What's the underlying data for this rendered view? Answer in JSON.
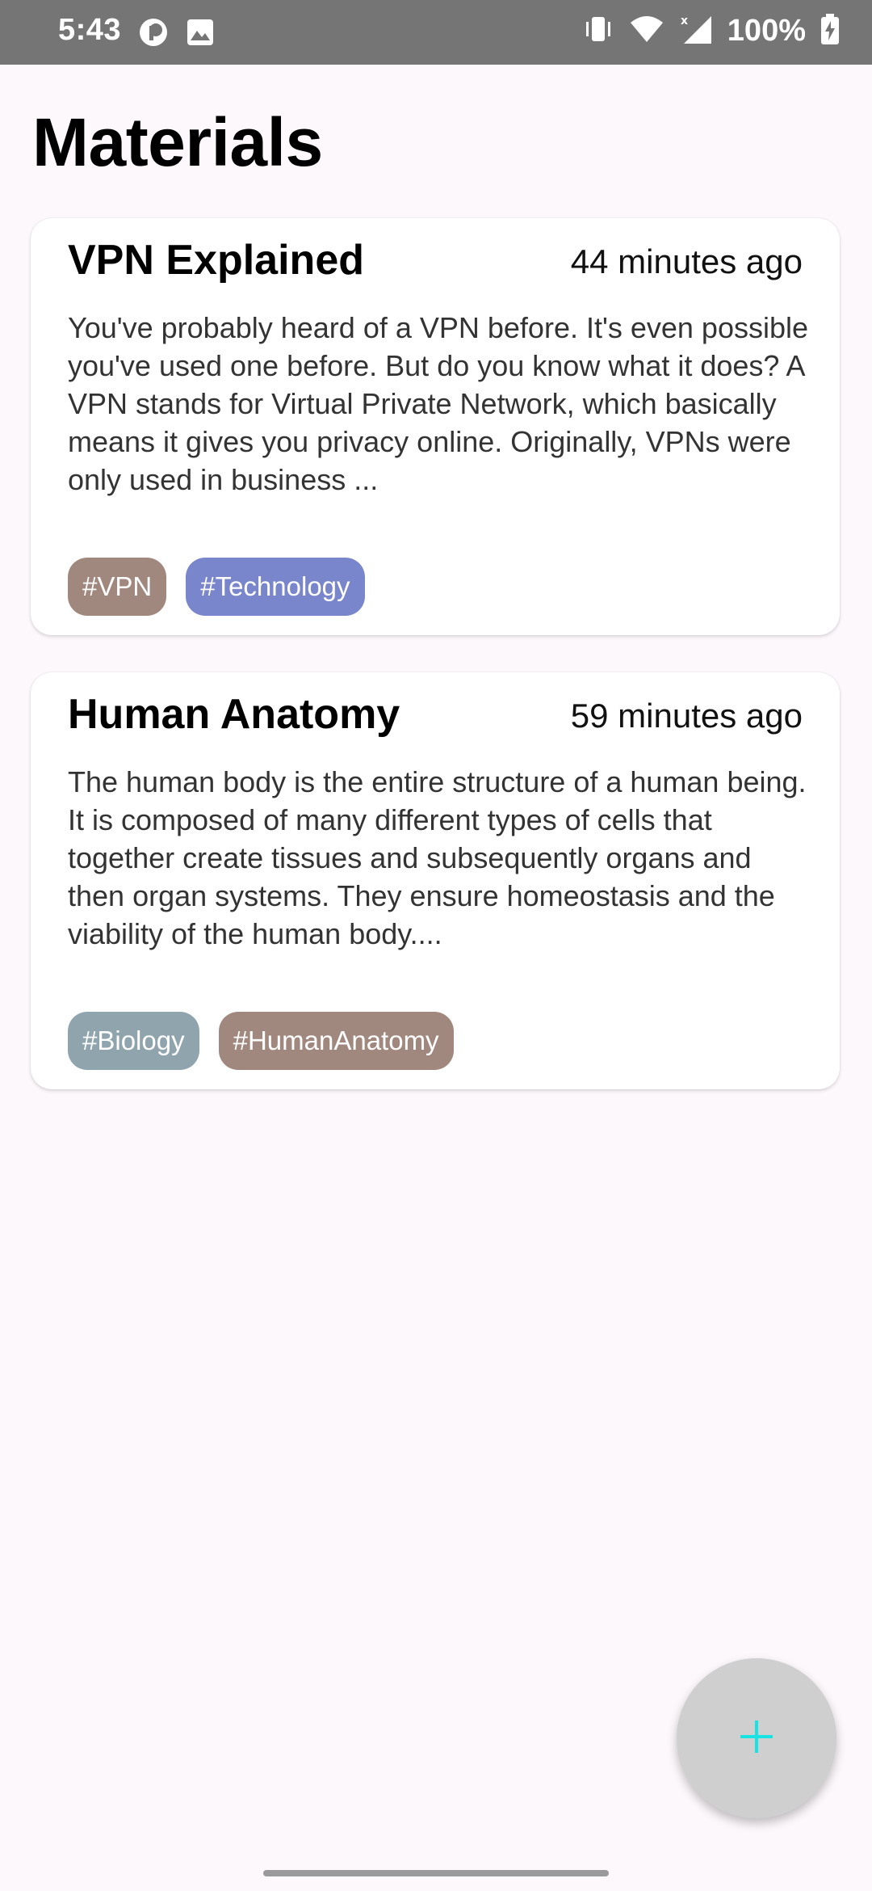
{
  "status_bar": {
    "time": "5:43",
    "left_icons": [
      "circle-half-icon",
      "image-icon"
    ],
    "right_icons": [
      "vibrate-icon",
      "wifi-icon",
      "signal-icon",
      "battery-charging-icon"
    ],
    "battery": "100%"
  },
  "page": {
    "title": "Materials"
  },
  "materials": [
    {
      "title": "VPN Explained",
      "time": "44 minutes ago",
      "body": "You've probably heard of a VPN before. It's even possible you've used one before. But do you know what it does? A VPN stands for Virtual Private Network, which basically means it gives you privacy online. Originally, VPNs were only used in business ...",
      "tags": [
        {
          "label": "#VPN",
          "color": "#a1887f"
        },
        {
          "label": "#Technology",
          "color": "#7986cb"
        }
      ]
    },
    {
      "title": "Human Anatomy",
      "time": "59 minutes ago",
      "body": "The human body is the entire structure of a human being. It is composed of many different types of cells that together create tissues and subsequently organs and then organ systems. They ensure homeostasis and the viability of the human body....",
      "tags": [
        {
          "label": "#Biology",
          "color": "#90a4ae"
        },
        {
          "label": "#HumanAnatomy",
          "color": "#a1887f"
        }
      ]
    }
  ],
  "fab": {
    "icon": "plus-icon",
    "icon_color": "#18e3e3"
  },
  "colors": {
    "status_bar": "#757575",
    "background": "#fdf8fc",
    "card": "#ffffff",
    "fab": "#cfcfcf"
  }
}
